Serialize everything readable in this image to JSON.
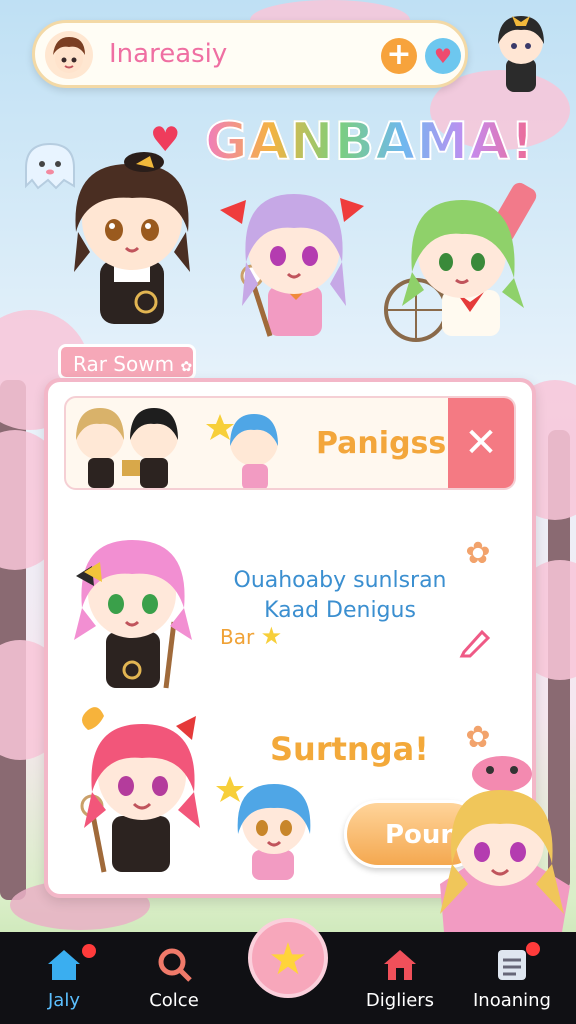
{
  "topbar": {
    "title": "Inareasiy",
    "add_icon": "+",
    "heart_icon": "♥"
  },
  "logo": "GANBAMA!",
  "section_tag": "Rar Sowm",
  "banner": {
    "title": "Panigss",
    "close_icon": "✕"
  },
  "row": {
    "title": "Ouahoaby sunlsran Kaad Denigus",
    "sub": "Bar",
    "star": "★"
  },
  "shout": "Surtnga!",
  "action_button": "Poun",
  "nav": [
    {
      "label": "Jaly",
      "active": true
    },
    {
      "label": "Colce"
    },
    {
      "label": "Digliers"
    },
    {
      "label": "Inoaning"
    }
  ],
  "colors": {
    "accent_pink": "#f47a83",
    "accent_orange": "#f3a63b",
    "accent_blue": "#3b8fd0",
    "nav_bg": "#101014"
  }
}
